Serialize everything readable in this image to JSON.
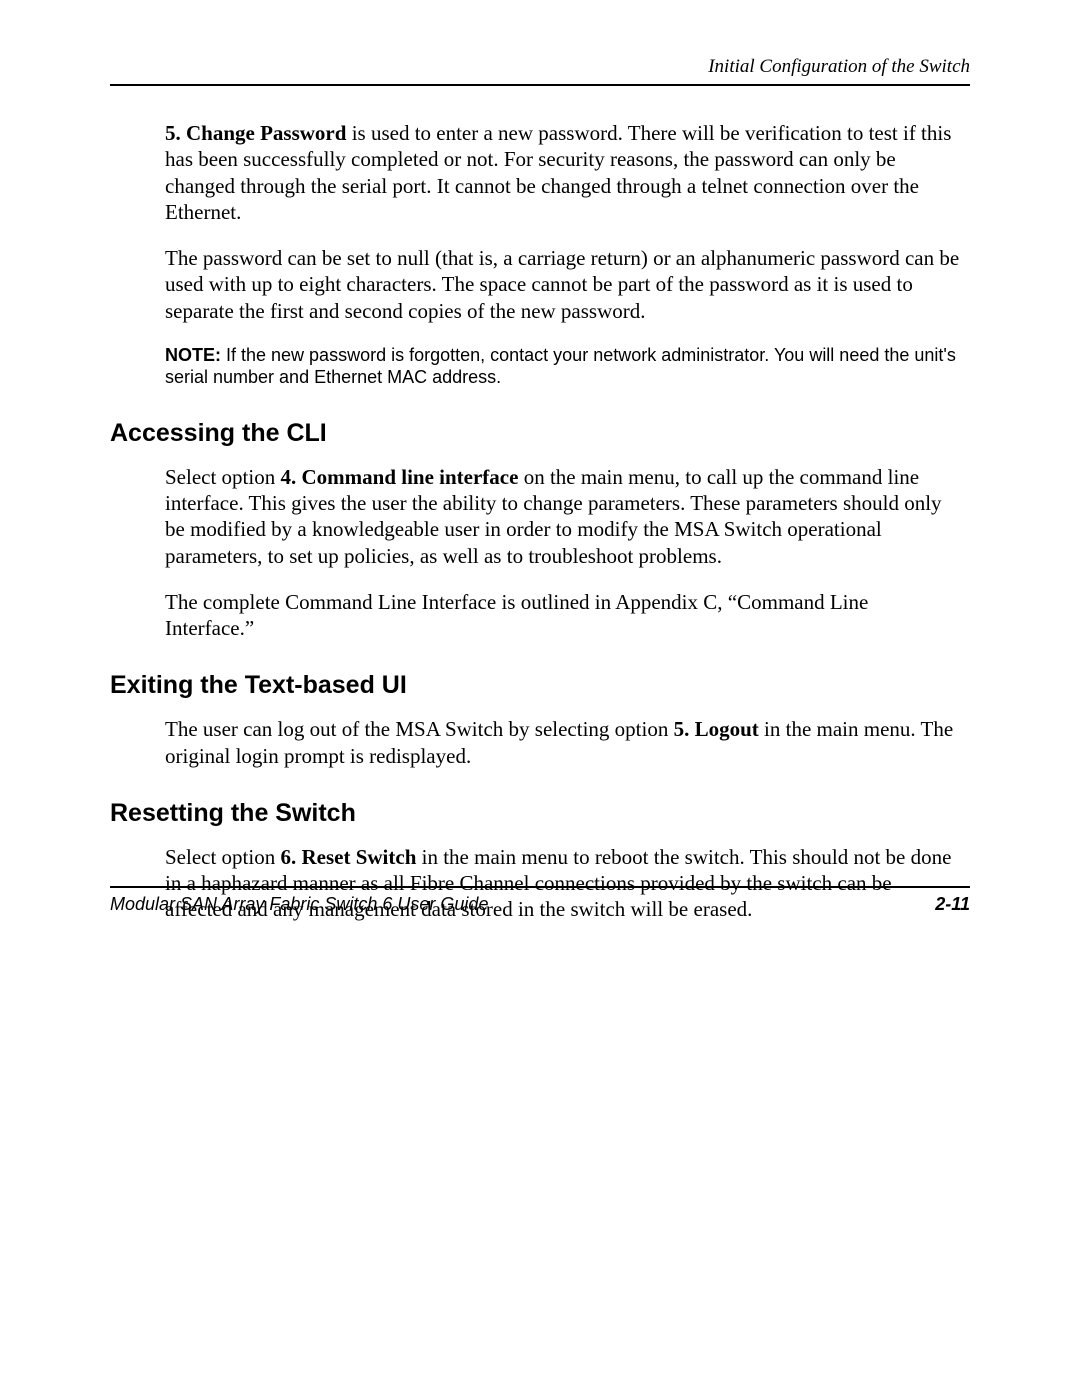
{
  "runningHead": "Initial Configuration of the Switch",
  "changePassword": {
    "lead": "5. Change Password",
    "p1_rest": " is used to enter a new password. There will be verification to test if this has been successfully completed or not. For security reasons, the password can only be changed through the serial port. It cannot be changed through a telnet connection over the Ethernet.",
    "p2": "The password can be set to null (that is, a carriage return) or an alphanumeric password can be used with up to eight characters. The space cannot be part of the password as it is used to separate the first and second copies of the new password.",
    "noteLabel": "NOTE:",
    "noteText": "  If the new password is forgotten, contact your network administrator. You will need the unit's serial number and Ethernet MAC address."
  },
  "cli": {
    "heading": "Accessing the CLI",
    "p1_a": "Select option ",
    "p1_bold": "4. Command line interface",
    "p1_b": " on the main menu, to call up the command line interface. This gives the user the ability to change parameters. These parameters should only be modified by a knowledgeable user in order to modify the MSA Switch operational parameters, to set up policies, as well as to troubleshoot problems.",
    "p2": "The complete Command Line Interface is outlined in Appendix C, “Command Line Interface.”"
  },
  "exiting": {
    "heading": "Exiting the Text-based UI",
    "p1_a": "The user can log out of the MSA Switch by selecting option ",
    "p1_bold": "5. Logout",
    "p1_b": " in the main menu. The original login prompt is redisplayed."
  },
  "resetting": {
    "heading": "Resetting the Switch",
    "p1_a": "Select option ",
    "p1_bold": "6. Reset Switch",
    "p1_b": " in the main menu to reboot the switch. This should not be done in a haphazard manner as all Fibre Channel connections provided by the switch can be affected and any management data stored in the switch will be erased."
  },
  "footer": {
    "title": "Modular SAN Array Fabric Switch 6 User Guide",
    "pageNumber": "2-11"
  }
}
